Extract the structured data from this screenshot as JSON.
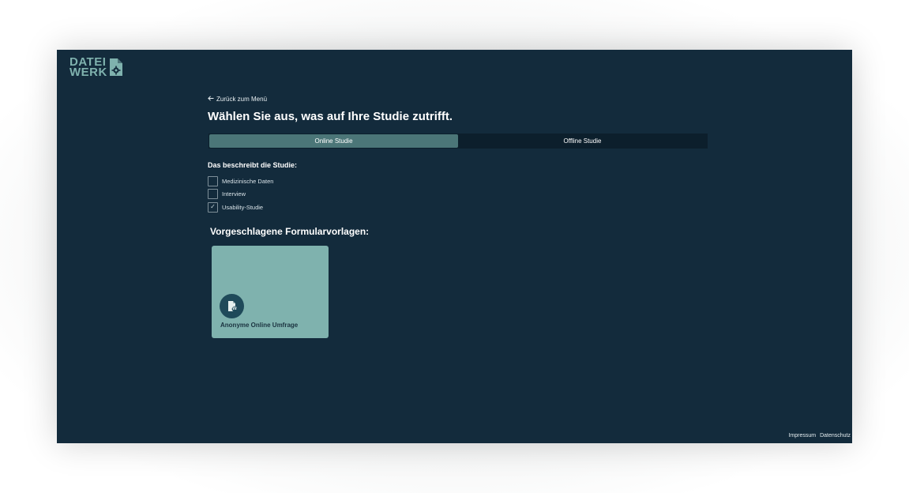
{
  "brand": {
    "line1": "DATEI",
    "line2": "WERK",
    "icon": "document-gear-icon",
    "color": "#7fb2ae"
  },
  "nav": {
    "back_icon": "arrow-left-icon",
    "back_label": "Zurück zum Menü"
  },
  "page": {
    "title": "Wählen Sie aus, was auf Ihre Studie zutrifft."
  },
  "tabs": [
    {
      "label": "Online Studie",
      "active": true
    },
    {
      "label": "Offline Studie",
      "active": false
    }
  ],
  "study": {
    "label": "Das beschreibt die Studie:",
    "options": [
      {
        "label": "Medizinische Daten",
        "checked": false
      },
      {
        "label": "Interview",
        "checked": false
      },
      {
        "label": "Usability-Studie",
        "checked": true
      }
    ],
    "check_glyph": "✓"
  },
  "templates": {
    "title": "Vorgeschlagene Formularvorlagen:",
    "cards": [
      {
        "title": "Anonyme Online Umfrage",
        "icon": "anonymous-document-icon"
      }
    ]
  },
  "footer": {
    "impressum": "Impressum",
    "datenschutz": "Datenschutz"
  },
  "colors": {
    "background": "#132b3c",
    "accent": "#7fb2ae",
    "tab_active": "#4b7678",
    "tab_bar": "#0c1f2c"
  }
}
